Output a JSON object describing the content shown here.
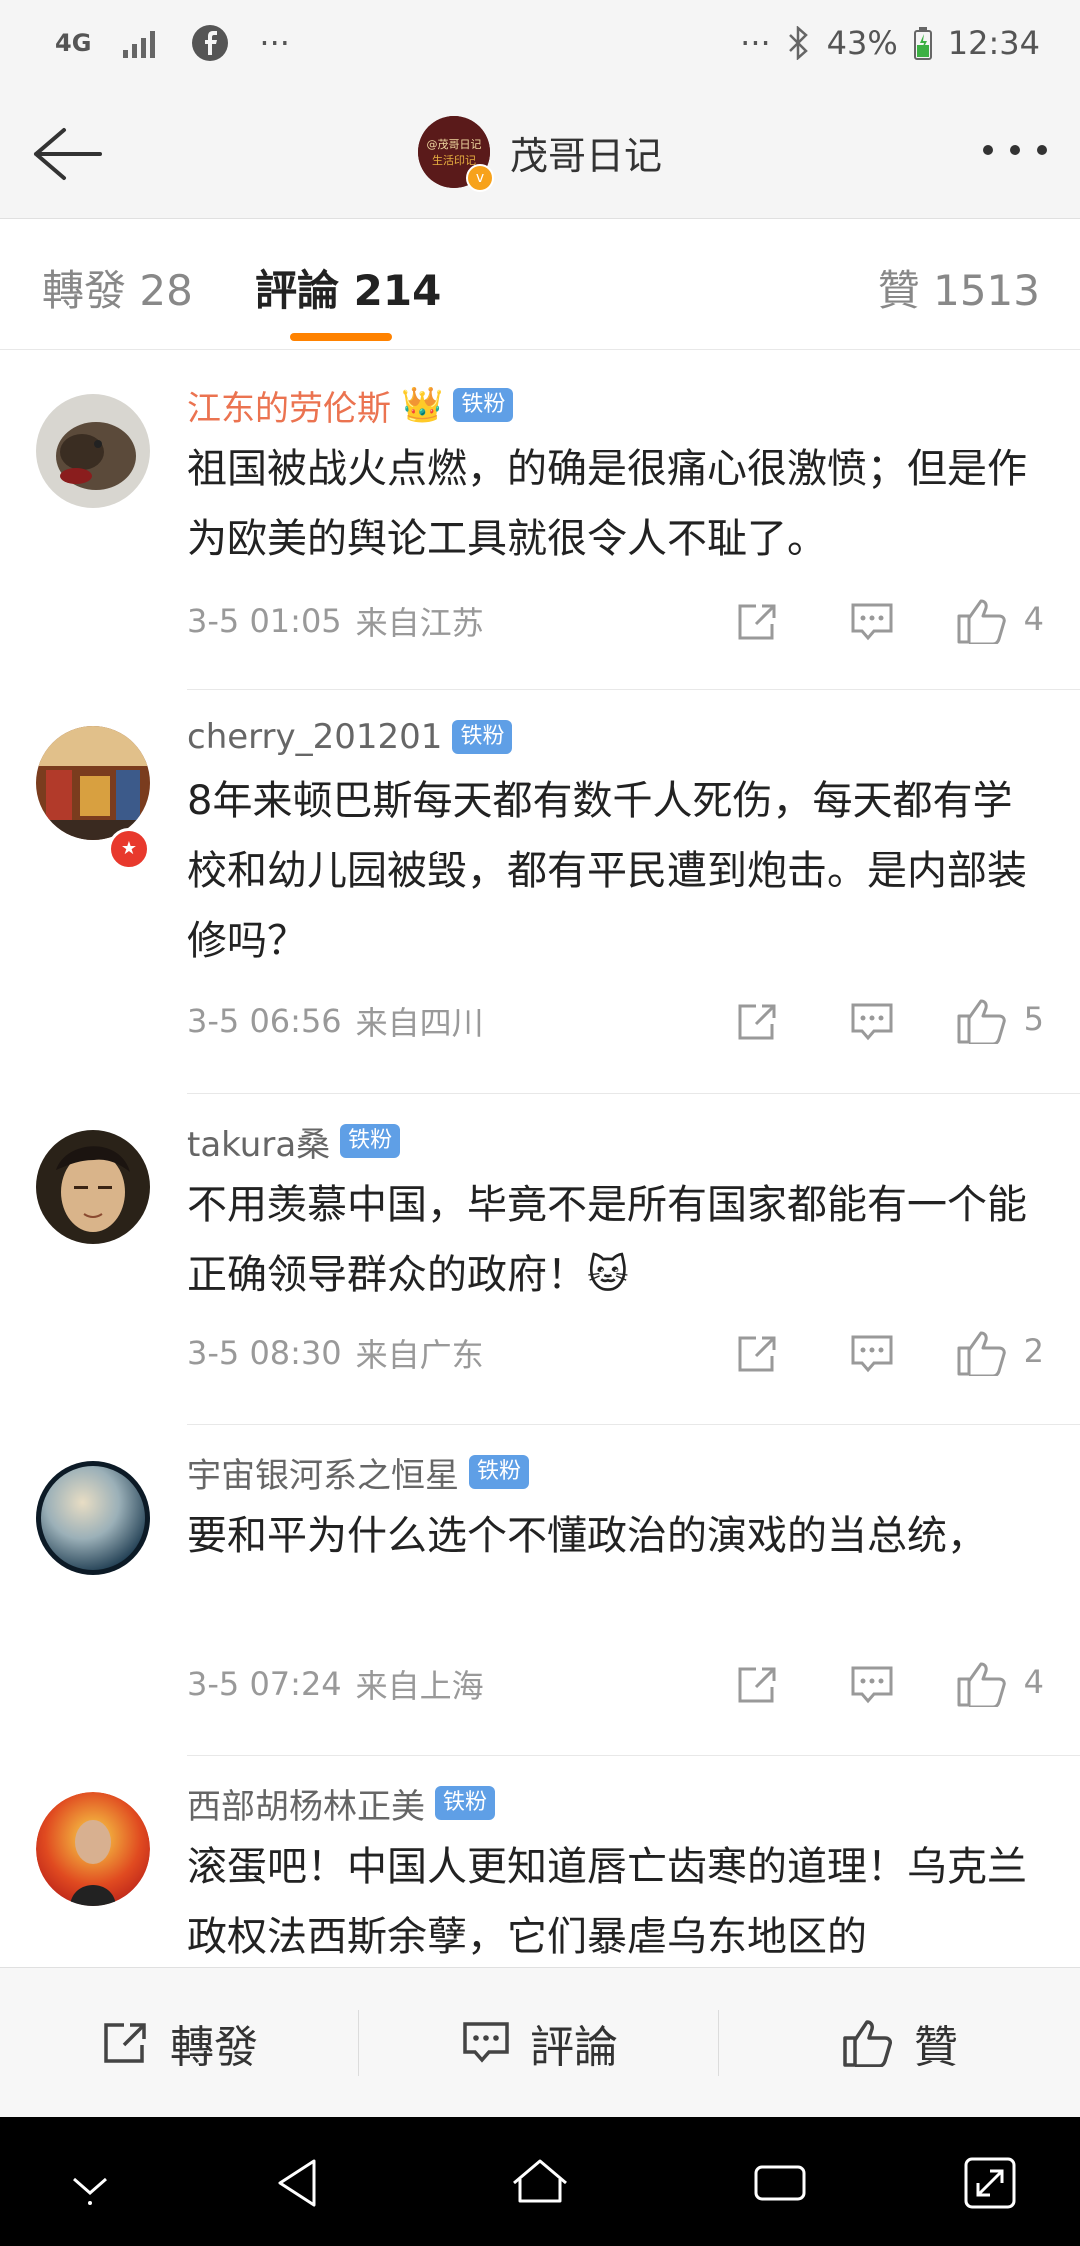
{
  "status_bar": {
    "network": "4G",
    "more_left": "···",
    "more_right": "···",
    "battery": "43%",
    "time": "12:34"
  },
  "nav": {
    "title": "茂哥日记",
    "avatar_text": "@茂哥日记 生活印记"
  },
  "tabs": {
    "repost": "轉發 28",
    "comments": "評論 214",
    "likes": "贊 1513"
  },
  "comments": [
    {
      "name": "江东的劳伦斯",
      "badge": "铁粉",
      "text": "祖国被战火点燃，的确是很痛心很激愤；但是作为欧美的舆论工具就很令人不耻了。",
      "time": "3-5 01:05",
      "source": "来自江苏",
      "likes": "4"
    },
    {
      "name": "cherry_201201",
      "badge": "铁粉",
      "text": "8年来顿巴斯每天都有数千人死伤，每天都有学校和幼儿园被毁，都有平民遭到炮击。是内部装修吗？",
      "time": "3-5 06:56",
      "source": "来自四川",
      "likes": "5"
    },
    {
      "name": "takura桑",
      "badge": "铁粉",
      "text": "不用羡慕中国，毕竟不是所有国家都能有一个能正确领导群众的政府！",
      "time": "3-5 08:30",
      "source": "来自广东",
      "likes": "2"
    },
    {
      "name": "宇宙银河系之恒星",
      "badge": "铁粉",
      "text": "要和平为什么选个不懂政治的演戏的当总统，",
      "time": "3-5 07:24",
      "source": "来自上海",
      "likes": "4"
    },
    {
      "name": "西部胡杨林正美",
      "badge": "铁粉",
      "text": "滚蛋吧！中国人更知道唇亡齿寒的道理！乌克兰政权法西斯余孽，它们暴虐乌东地区的",
      "time": "",
      "source": "",
      "likes": ""
    }
  ],
  "bottom_bar": {
    "repost": "轉發",
    "comment": "評論",
    "like": "贊"
  },
  "colors": {
    "accent": "#ff8200",
    "vip_name": "#eb7350",
    "badge": "#5f9fe6"
  }
}
